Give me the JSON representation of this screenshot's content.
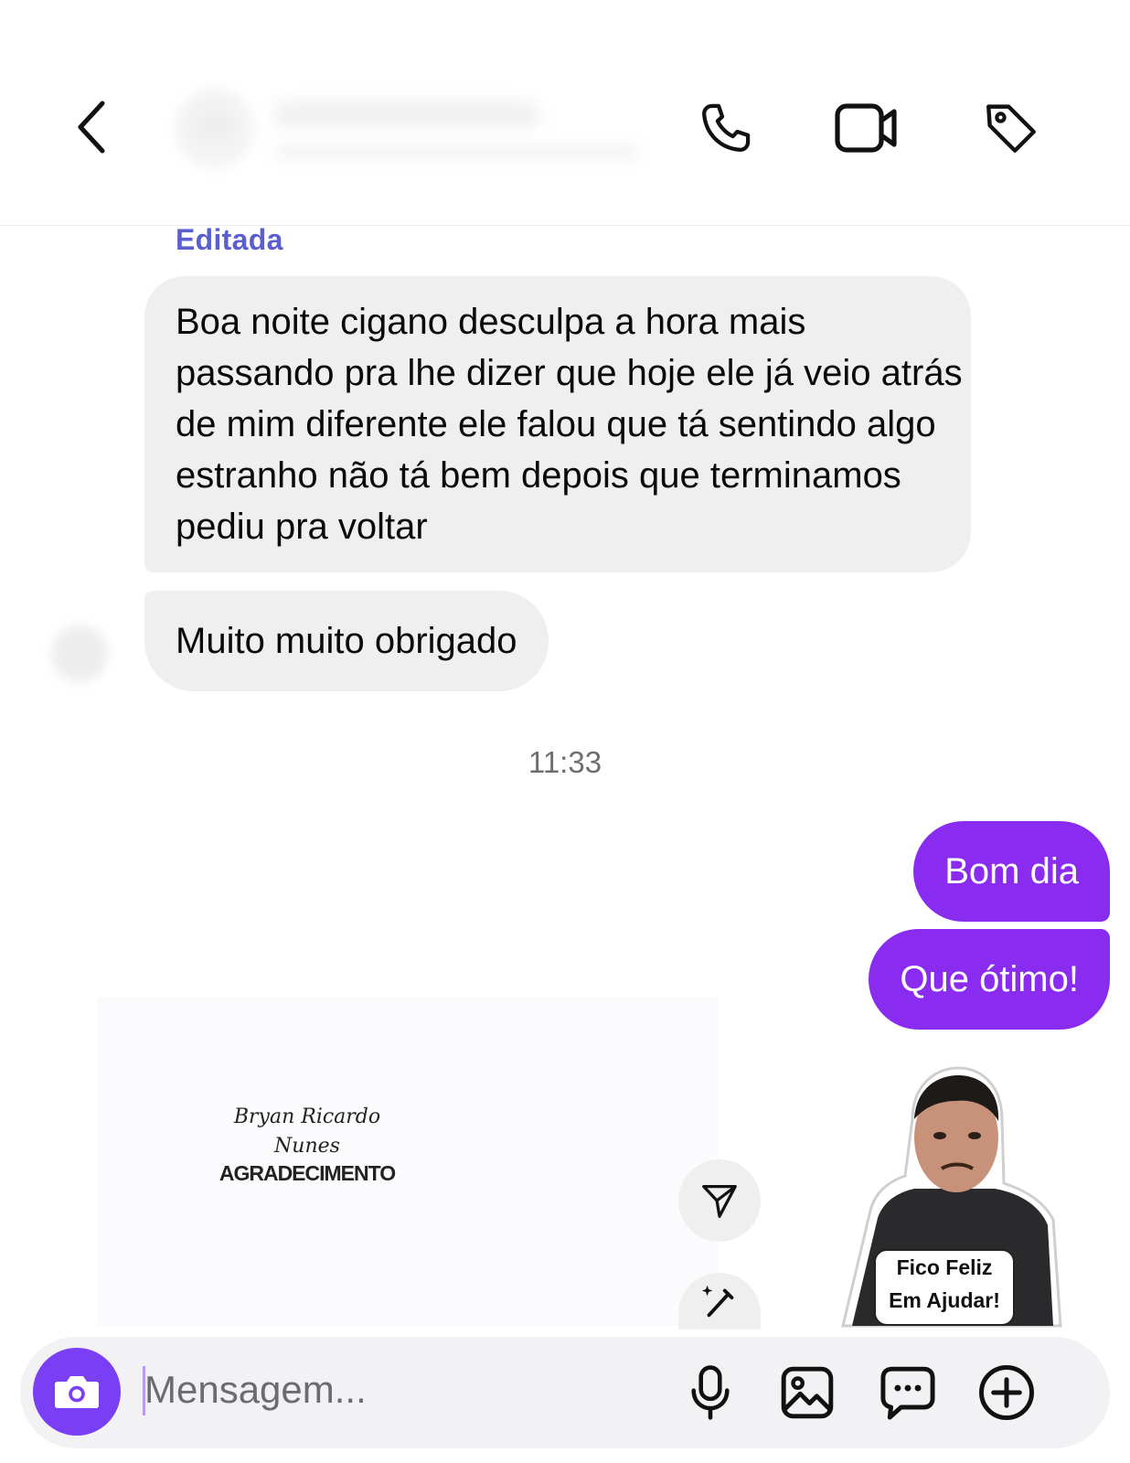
{
  "header": {
    "back_icon": "chevron-left-icon",
    "actions": [
      {
        "name": "phone-call-button",
        "icon": "phone-icon"
      },
      {
        "name": "video-call-button",
        "icon": "video-camera-icon"
      },
      {
        "name": "tag-button",
        "icon": "tag-icon"
      }
    ]
  },
  "messages": {
    "edited_label": "Editada",
    "incoming": [
      {
        "text": "Boa noite cigano desculpa a hora mais passando pra lhe dizer que hoje ele já veio atrás de mim diferente ele falou que tá sentindo algo estranho não tá bem depois que terminamos pediu pra voltar"
      },
      {
        "text": "Muito muito obrigado"
      }
    ],
    "timestamp": "11:33",
    "outgoing": [
      {
        "text": "Bom dia"
      },
      {
        "text": "Que ótimo!"
      }
    ]
  },
  "attachment": {
    "signature_line1": "Bryan Ricardo",
    "signature_line2": "Nunes",
    "title": "AGRADECIMENTO"
  },
  "floating_actions": [
    {
      "name": "share-button",
      "icon": "paper-plane-icon"
    },
    {
      "name": "edit-ai-button",
      "icon": "magic-brush-icon"
    }
  ],
  "sticker": {
    "text_line1": "Fico Feliz",
    "text_line2": "Em Ajudar!"
  },
  "composer": {
    "placeholder": "Mensagem...",
    "camera_icon": "camera-icon",
    "actions": [
      {
        "name": "microphone-button",
        "icon": "microphone-icon"
      },
      {
        "name": "gallery-button",
        "icon": "image-icon"
      },
      {
        "name": "sticker-button",
        "icon": "chat-bubble-icon"
      },
      {
        "name": "more-button",
        "icon": "plus-circle-icon"
      }
    ]
  },
  "colors": {
    "outgoing_bubble": "#8a2cf0",
    "incoming_bubble": "#efeff0",
    "accent": "#7a3ef5",
    "edited_label": "#5b5ecf"
  }
}
